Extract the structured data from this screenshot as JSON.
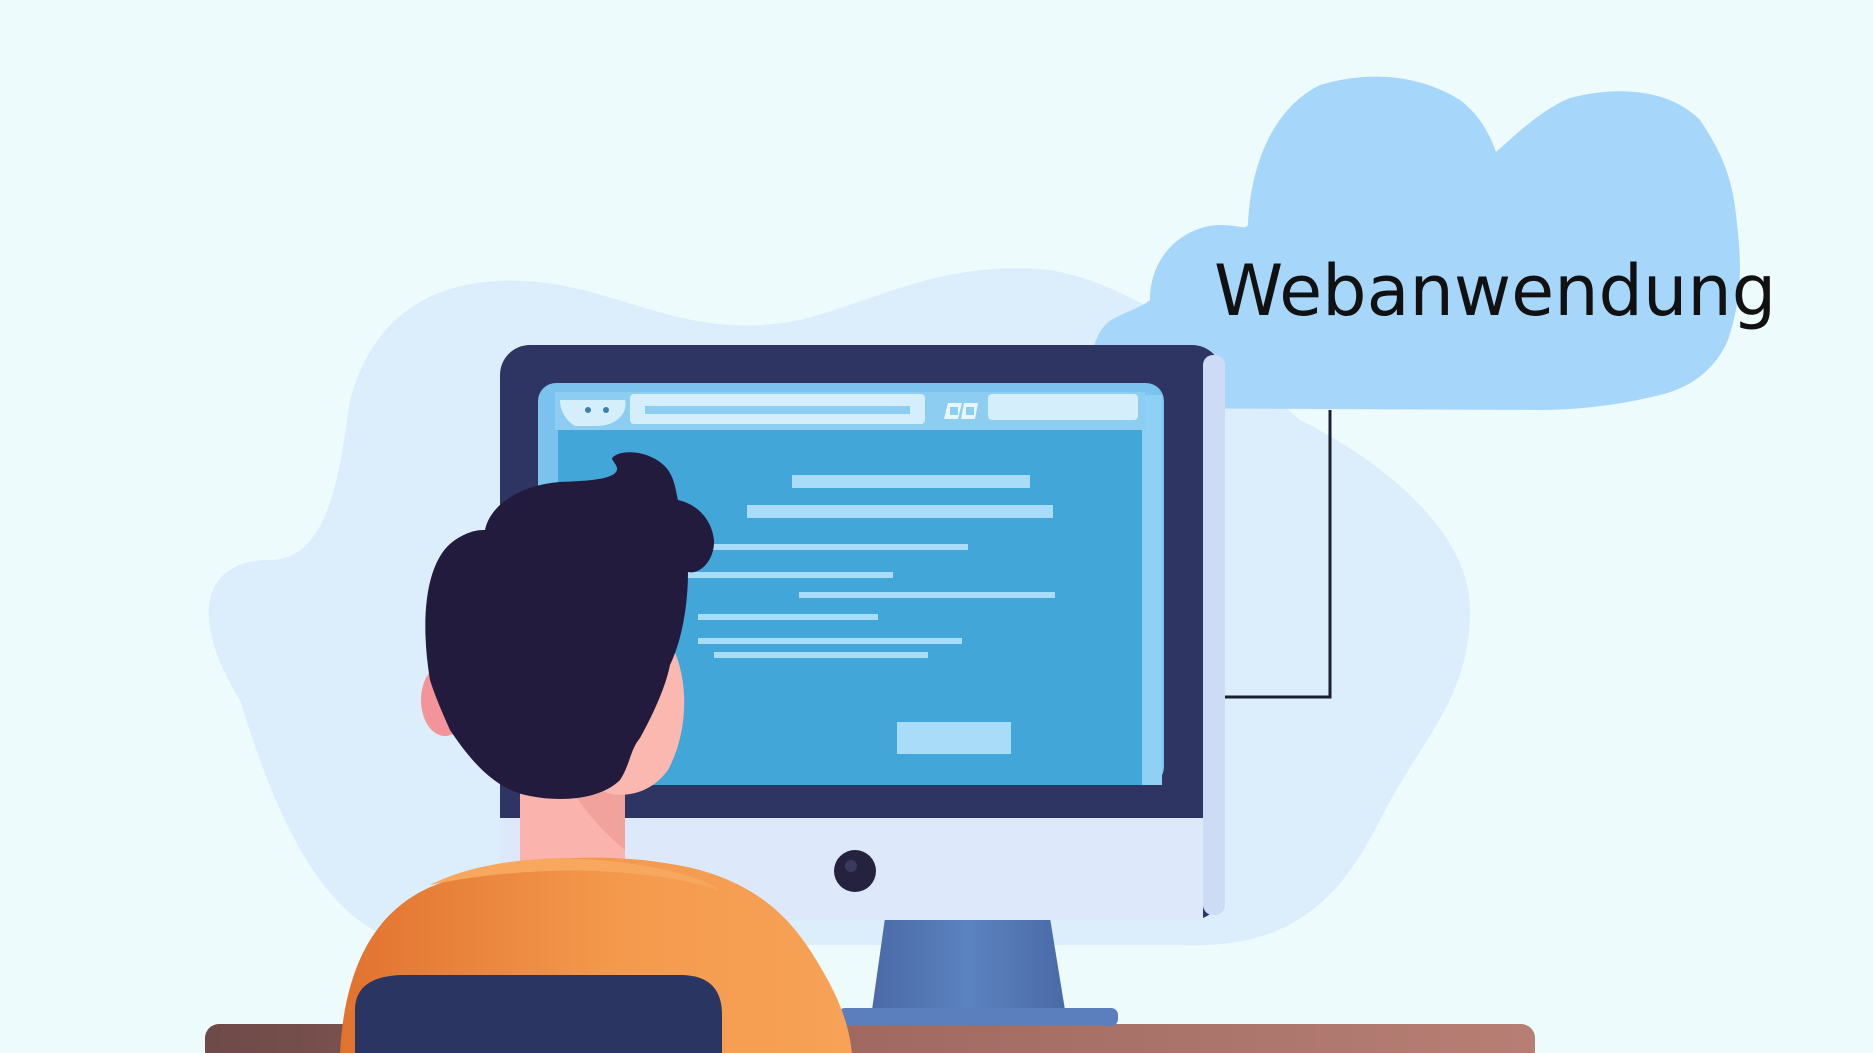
{
  "cloud": {
    "label": "Webanwendung"
  },
  "colors": {
    "background": "#eefbfd",
    "backdrop_blob": "#dcedfb",
    "cloud": "#a7d6fb",
    "monitor_frame": "#2e3562",
    "monitor_chin": "#dde9fb",
    "screen": "#42a6d8",
    "screen_lines": "#a8dcf8",
    "hair": "#221b3d",
    "skin": "#fbb8b1",
    "shirt": "#f49a4d",
    "chair": "#2b3561",
    "desk": "#b0766c",
    "stand": "#5479b3"
  },
  "icons": {
    "scene": "person-at-computer-illustration",
    "cloud": "cloud-icon",
    "connector": "connector-line"
  }
}
